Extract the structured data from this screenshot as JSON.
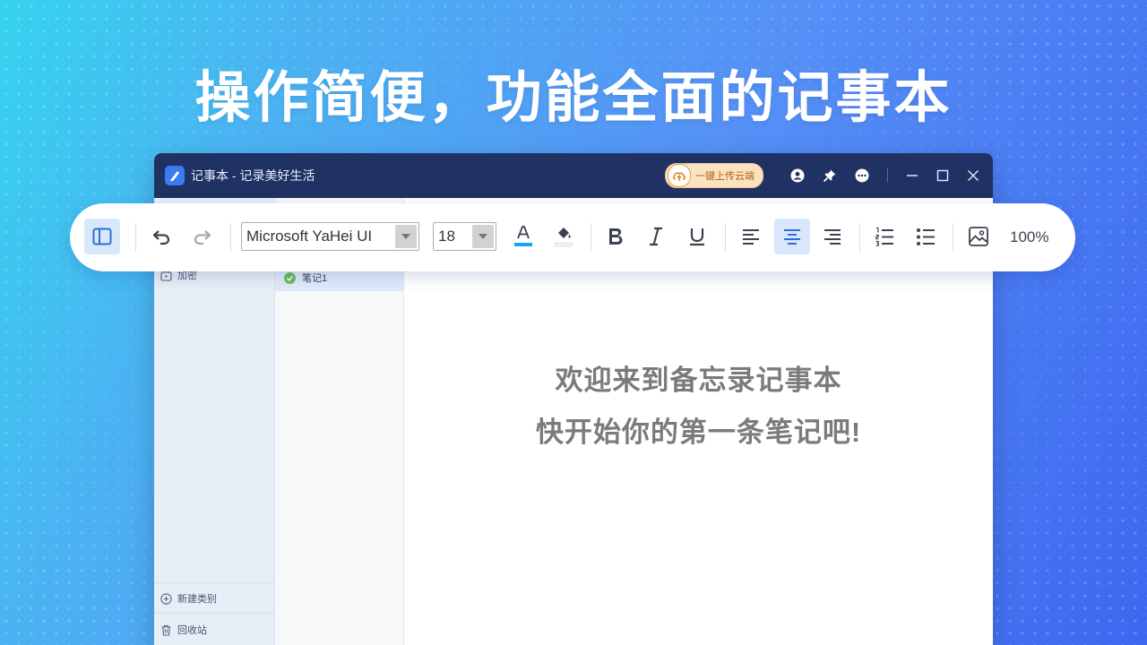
{
  "headline": "操作简便，功能全面的记事本",
  "window": {
    "title": "记事本 - 记录美好生活",
    "upload_label": "一键上传云端",
    "icons": [
      "user-icon",
      "pin-icon",
      "more-icon",
      "minimize-icon",
      "maximize-icon",
      "close-icon"
    ]
  },
  "toolbar": {
    "font_family": "Microsoft YaHei UI",
    "font_size": "18",
    "zoom": "100%",
    "active_buttons": [
      "toggle-sidebar",
      "align-center"
    ],
    "text_color": "#1aa3f0"
  },
  "sidebar": {
    "items": [
      {
        "label": "加密",
        "icon": "lock-icon"
      },
      {
        "label": "新建类别",
        "icon": "add-circle-icon"
      },
      {
        "label": "回收站",
        "icon": "trash-icon"
      }
    ]
  },
  "notes": [
    {
      "title": "笔记1",
      "status": "saved"
    }
  ],
  "editor": {
    "line1": "欢迎来到备忘录记事本",
    "line2": "快开始你的第一条笔记吧!"
  },
  "colors": {
    "titlebar": "#1f3263",
    "accent": "#3a7af2",
    "selected_note": "#e1eafa"
  }
}
